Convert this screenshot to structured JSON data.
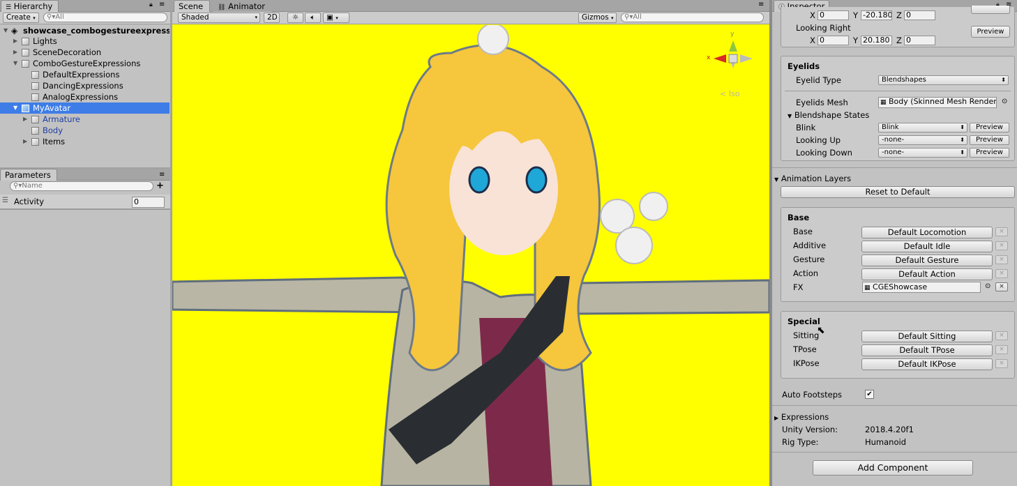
{
  "hierarchy": {
    "tab_label": "Hierarchy",
    "create_label": "Create",
    "search_placeholder": "All",
    "scene_name": "showcase_combogestureexpressions",
    "items": [
      {
        "label": "Lights",
        "kind": "object"
      },
      {
        "label": "SceneDecoration",
        "kind": "object"
      },
      {
        "label": "ComboGestureExpressions",
        "kind": "object"
      },
      {
        "label": "DefaultExpressions",
        "kind": "object"
      },
      {
        "label": "DancingExpressions",
        "kind": "object"
      },
      {
        "label": "AnalogExpressions",
        "kind": "object"
      },
      {
        "label": "MyAvatar",
        "kind": "prefab",
        "selected": true
      },
      {
        "label": "Armature",
        "kind": "prefab"
      },
      {
        "label": "Body",
        "kind": "prefab"
      },
      {
        "label": "Items",
        "kind": "object"
      }
    ]
  },
  "parameters": {
    "tab_label": "Parameters",
    "search_placeholder": "Name",
    "add_label": "+",
    "rows": [
      {
        "name": "Activity",
        "value": "0"
      }
    ]
  },
  "scene": {
    "tabs": [
      {
        "label": "Scene",
        "active": true
      },
      {
        "label": "Animator",
        "active": false
      }
    ],
    "shading_mode": "Shaded",
    "mode_2d": "2D",
    "gizmos_label": "Gizmos",
    "search_placeholder": "All",
    "projection_label": "< Iso",
    "gizmo_axes": {
      "y": "y",
      "x": "x"
    },
    "background_color": "#ffff00"
  },
  "inspector": {
    "tab_label": "Inspector",
    "top_row": {
      "x": "0",
      "y": "-20.180",
      "z": "0"
    },
    "looking_right": {
      "label": "Looking Right",
      "x": "0",
      "y": "20.180",
      "z": "0",
      "preview": "Preview"
    },
    "axis_labels": {
      "x": "X",
      "y": "Y",
      "z": "Z"
    },
    "eyelids": {
      "title": "Eyelids",
      "type_label": "Eyelid Type",
      "type_value": "Blendshapes",
      "mesh_label": "Eyelids Mesh",
      "mesh_value": "Body (Skinned Mesh Renderer)",
      "states_label": "Blendshape States",
      "states": [
        {
          "label": "Blink",
          "value": "Blink",
          "preview": "Preview"
        },
        {
          "label": "Looking Up",
          "value": "-none-",
          "preview": "Preview"
        },
        {
          "label": "Looking Down",
          "value": "-none-",
          "preview": "Preview"
        }
      ]
    },
    "animation_layers": {
      "title": "Animation Layers",
      "reset_label": "Reset to Default",
      "base": {
        "title": "Base",
        "layers": [
          {
            "label": "Base",
            "value": "Default Locomotion",
            "removable": false
          },
          {
            "label": "Additive",
            "value": "Default Idle",
            "removable": false
          },
          {
            "label": "Gesture",
            "value": "Default Gesture",
            "removable": false
          },
          {
            "label": "Action",
            "value": "Default Action",
            "removable": false
          },
          {
            "label": "FX",
            "value": "CGEShowcase",
            "removable": true,
            "is_object": true
          }
        ]
      },
      "special": {
        "title": "Special",
        "layers": [
          {
            "label": "Sitting",
            "value": "Default Sitting"
          },
          {
            "label": "TPose",
            "value": "Default TPose"
          },
          {
            "label": "IKPose",
            "value": "Default IKPose"
          }
        ]
      }
    },
    "auto_footsteps": {
      "label": "Auto Footsteps",
      "checked": true
    },
    "expressions_label": "Expressions",
    "unity_version": {
      "label": "Unity Version:",
      "value": "2018.4.20f1"
    },
    "rig_type": {
      "label": "Rig Type:",
      "value": "Humanoid"
    },
    "add_component_label": "Add Component",
    "remove_symbol": "×"
  }
}
